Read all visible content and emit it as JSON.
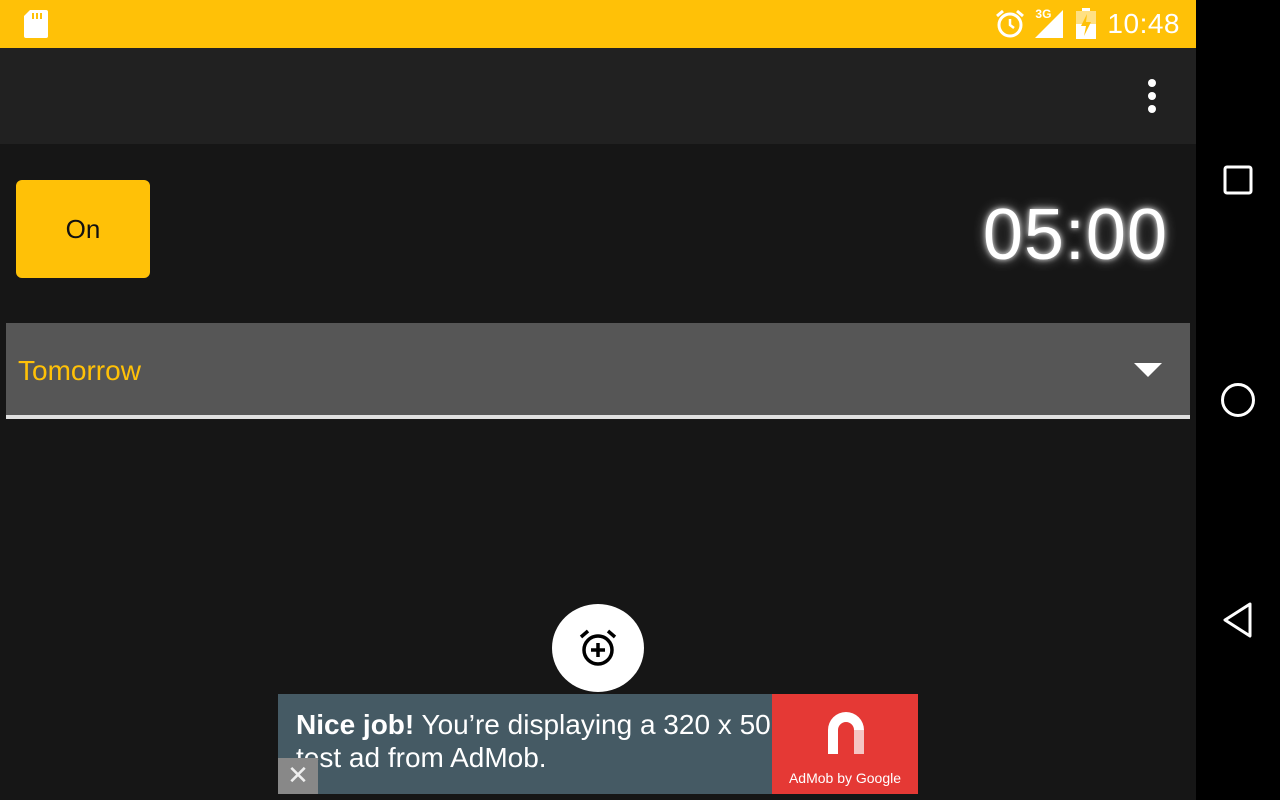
{
  "status_bar": {
    "time": "10:48",
    "network": "3G",
    "icons": [
      "sd-card-icon",
      "alarm-icon",
      "signal-icon",
      "battery-charging-icon"
    ],
    "background": "#FFC107"
  },
  "app_bar": {
    "overflow_icon": "more-vert-icon",
    "background": "#212121"
  },
  "alarm": {
    "toggle_label": "On",
    "time": "05:00",
    "day_selection": "Tomorrow"
  },
  "fab": {
    "icon": "add-alarm-icon"
  },
  "ad": {
    "headline_bold": "Nice job!",
    "headline_rest": " You’re displaying a 320 x 50 test ad from AdMob.",
    "logo_caption": "AdMob by Google",
    "close_icon": "close-icon"
  },
  "nav_bar": {
    "icons": [
      "recents-icon",
      "home-icon",
      "back-icon"
    ]
  },
  "colors": {
    "accent": "#FFC107",
    "content_background": "#161616",
    "spinner_background": "#565656",
    "ad_background": "#455A64",
    "admob_red": "#E53935"
  }
}
